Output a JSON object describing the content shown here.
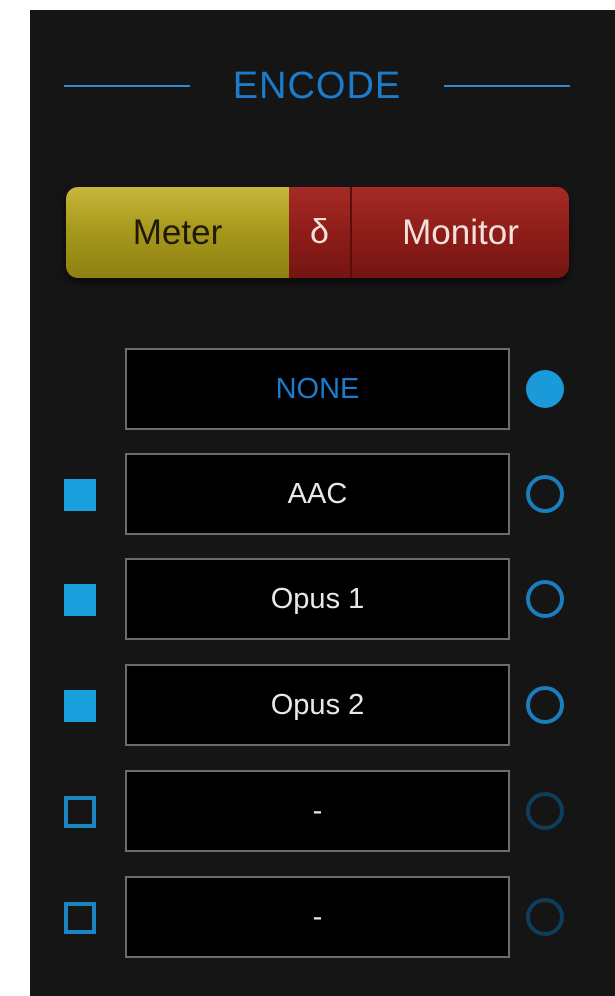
{
  "section": {
    "title": "ENCODE"
  },
  "toggles": {
    "meter": "Meter",
    "delta": "δ",
    "monitor": "Monitor"
  },
  "rows": [
    {
      "label": "NONE",
      "checkbox": "none",
      "radio": "selected"
    },
    {
      "label": "AAC",
      "checkbox": "checked",
      "radio": "unselected"
    },
    {
      "label": "Opus 1",
      "checkbox": "checked",
      "radio": "unselected"
    },
    {
      "label": "Opus 2",
      "checkbox": "checked",
      "radio": "unselected"
    },
    {
      "label": "-",
      "checkbox": "unchecked",
      "radio": "dim"
    },
    {
      "label": "-",
      "checkbox": "unchecked",
      "radio": "dim"
    }
  ],
  "colors": {
    "accent": "#1a9ad8",
    "meter": "#b0a223",
    "monitor": "#8c1c18",
    "background": "#151515"
  }
}
